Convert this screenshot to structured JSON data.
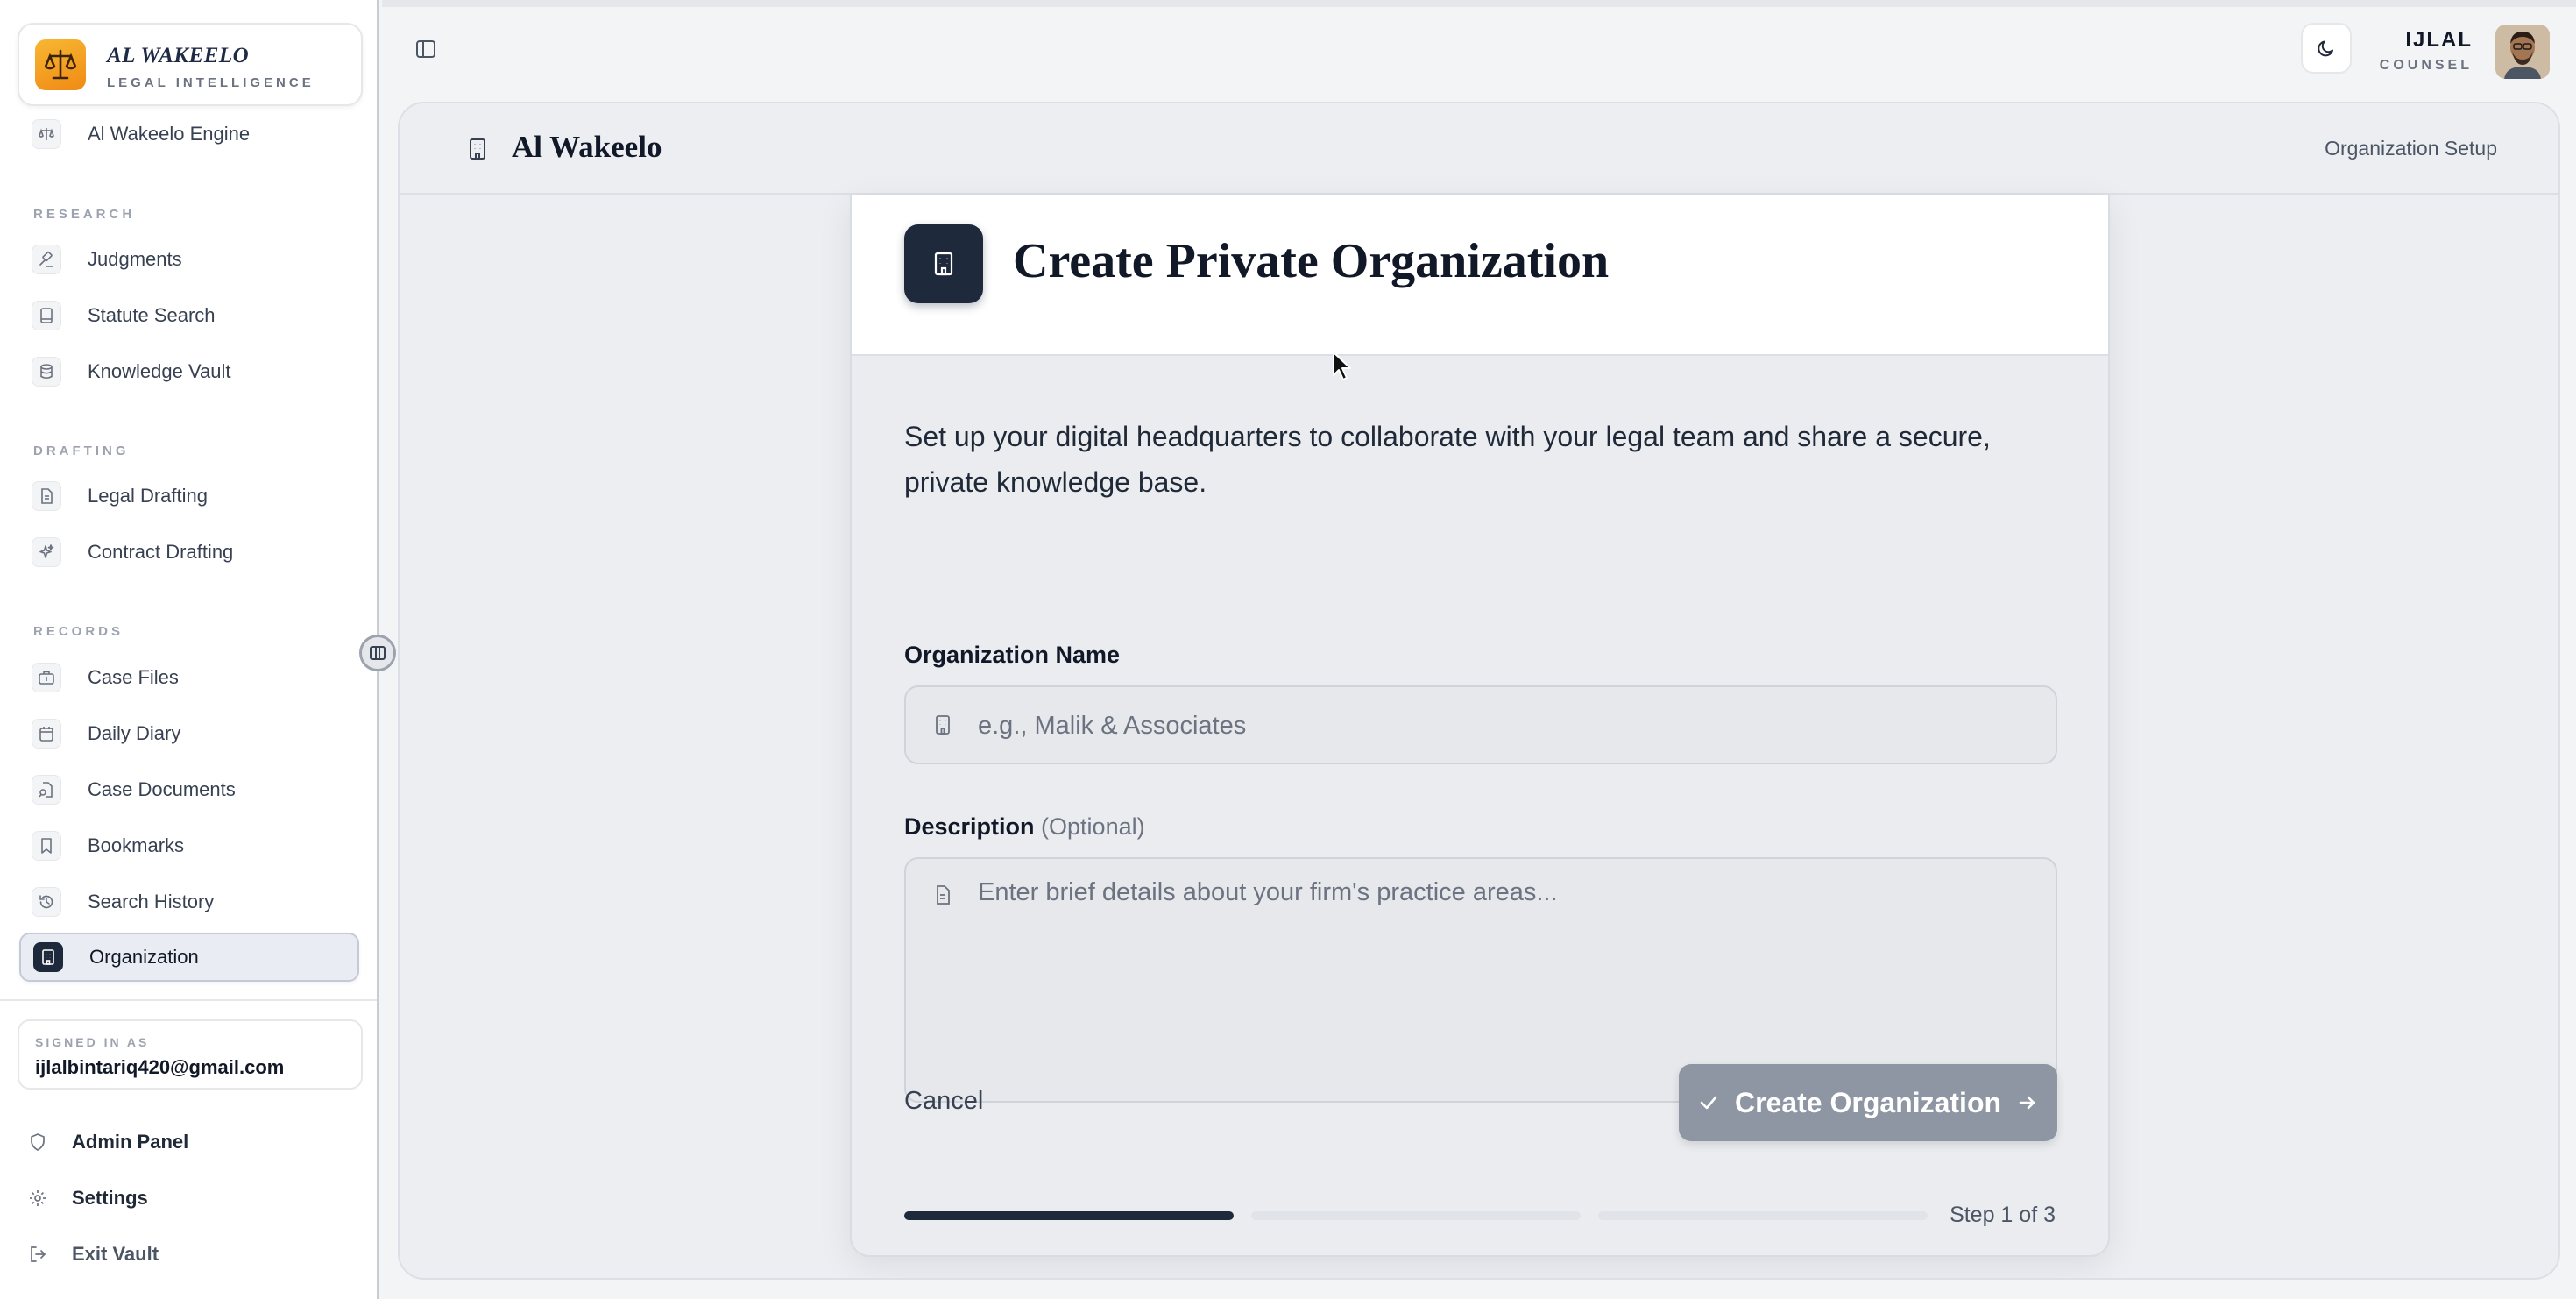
{
  "brand": {
    "name": "AL WAKEELO",
    "subtitle": "LEGAL INTELLIGENCE"
  },
  "sidebar": {
    "engine_item": {
      "label": "Al Wakeelo Engine",
      "icon": "scales-icon"
    },
    "sections": [
      {
        "title": "RESEARCH",
        "items": [
          {
            "label": "Judgments",
            "icon": "gavel-icon"
          },
          {
            "label": "Statute Search",
            "icon": "book-icon"
          },
          {
            "label": "Knowledge Vault",
            "icon": "database-icon"
          }
        ]
      },
      {
        "title": "DRAFTING",
        "items": [
          {
            "label": "Legal Drafting",
            "icon": "document-icon"
          },
          {
            "label": "Contract Drafting",
            "icon": "sparkle-icon"
          }
        ]
      },
      {
        "title": "RECORDS",
        "items": [
          {
            "label": "Case Files",
            "icon": "briefcase-icon"
          },
          {
            "label": "Daily Diary",
            "icon": "calendar-icon"
          },
          {
            "label": "Case Documents",
            "icon": "file-search-icon"
          },
          {
            "label": "Bookmarks",
            "icon": "bookmark-icon"
          },
          {
            "label": "Search History",
            "icon": "history-icon"
          },
          {
            "label": "Organization",
            "icon": "building-icon",
            "active": true
          }
        ]
      }
    ],
    "signed_in": {
      "label": "SIGNED IN AS",
      "email": "ijlalbintariq420@gmail.com"
    },
    "bottom": [
      {
        "label": "Admin Panel",
        "icon": "shield-icon"
      },
      {
        "label": "Settings",
        "icon": "gear-icon"
      },
      {
        "label": "Exit Vault",
        "icon": "logout-icon"
      }
    ]
  },
  "topbar": {
    "user_name": "IJLAL",
    "user_role": "COUNSEL"
  },
  "frame": {
    "title": "Al Wakeelo",
    "breadcrumb": "Organization Setup"
  },
  "card": {
    "title": "Create Private Organization",
    "description": "Set up your digital headquarters to collaborate with your legal team and share a secure, private knowledge base.",
    "name_label": "Organization Name",
    "name_placeholder": "e.g., Malik & Associates",
    "name_value": "",
    "desc_label": "Description",
    "desc_optional": "(Optional)",
    "desc_placeholder": "Enter brief details about your firm's practice areas...",
    "desc_value": "",
    "cancel_label": "Cancel",
    "create_label": "Create Organization",
    "step_text": "Step 1 of 3",
    "steps_total": 3,
    "current_step": 1
  },
  "colors": {
    "accent": "#1e293b",
    "brand_orange": "#f59e0b",
    "button_disabled": "#8f96a3"
  }
}
